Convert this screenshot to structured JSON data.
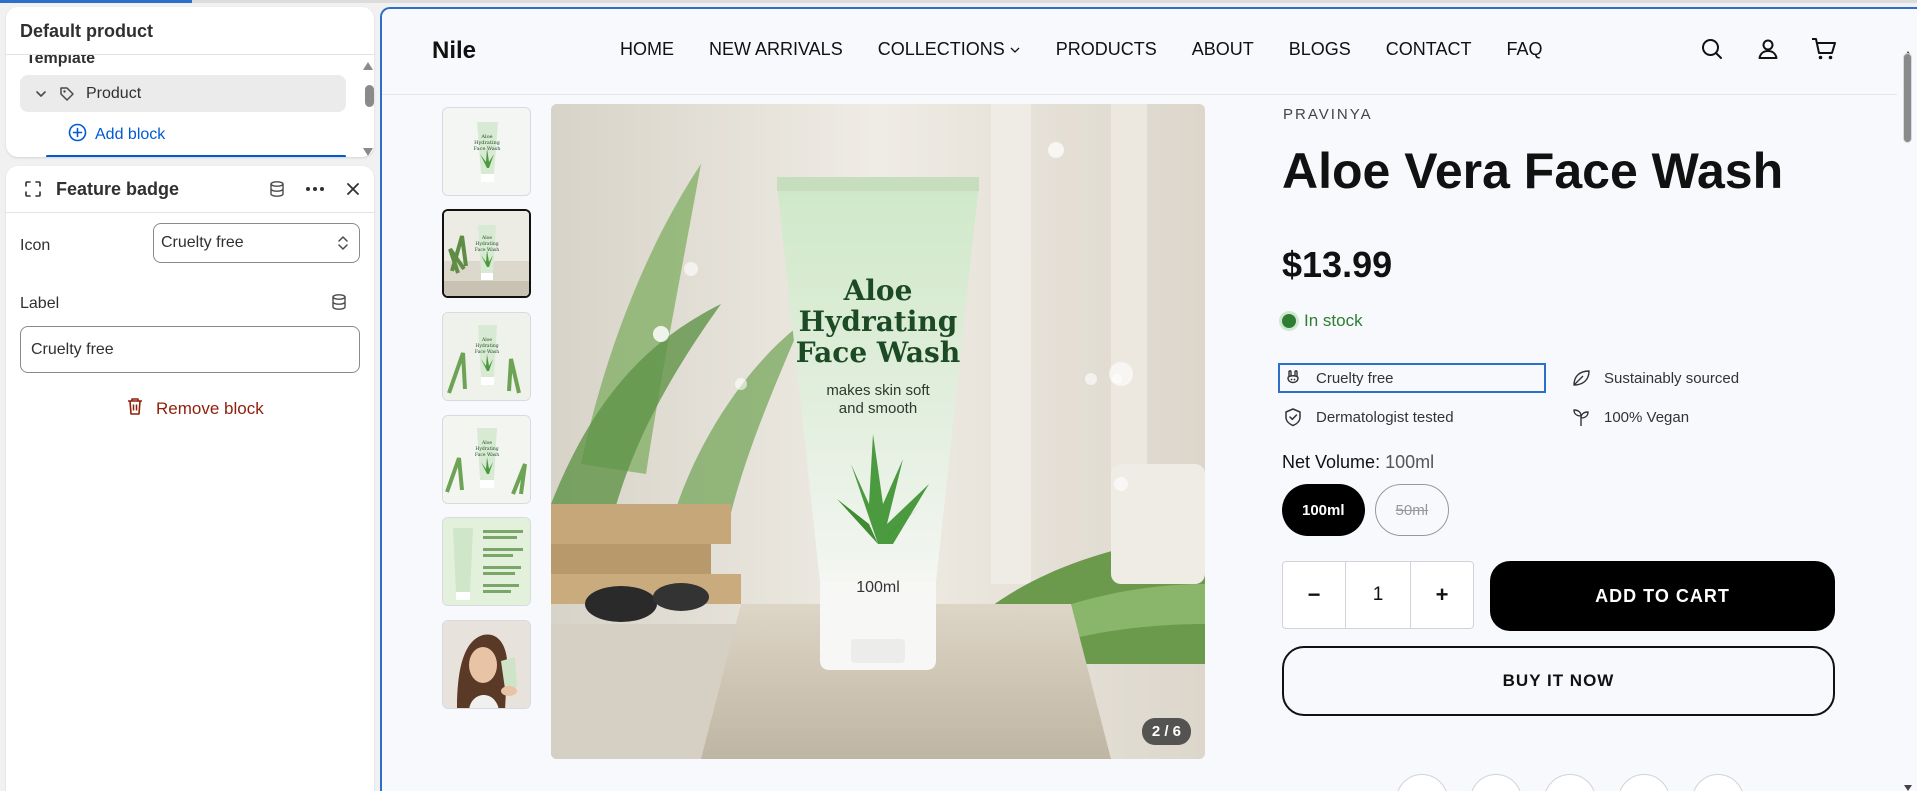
{
  "editor": {
    "tree": {
      "title": "Default product",
      "section_label": "Template",
      "product_label": "Product",
      "add_block_label": "Add block"
    },
    "block": {
      "title": "Feature badge",
      "icon_field_label": "Icon",
      "icon_value": "Cruelty free",
      "label_field_label": "Label",
      "label_value": "Cruelty free",
      "remove_label": "Remove block"
    }
  },
  "preview": {
    "logo": "Nile",
    "nav": [
      "HOME",
      "NEW ARRIVALS",
      "COLLECTIONS",
      "PRODUCTS",
      "ABOUT",
      "BLOGS",
      "CONTACT",
      "FAQ"
    ],
    "header_icons": [
      "search-icon",
      "account-icon",
      "cart-icon"
    ],
    "product": {
      "vendor": "PRAVINYA",
      "title": "Aloe Vera Face Wash",
      "price": "$13.99",
      "stock": "In stock",
      "badges": [
        {
          "icon": "cruelty-free-icon",
          "label": "Cruelty free"
        },
        {
          "icon": "leaf-icon",
          "label": "Sustainably sourced"
        },
        {
          "icon": "shield-icon",
          "label": "Dermatologist tested"
        },
        {
          "icon": "sprout-icon",
          "label": "100% Vegan"
        }
      ],
      "option_name": "Net Volume",
      "option_value": "100ml",
      "variants": [
        "100ml",
        "50ml"
      ],
      "quantity": "1",
      "qty_minus": "−",
      "qty_plus": "+",
      "add_to_cart": "ADD TO CART",
      "buy_now": "BUY IT NOW",
      "image_counter": "2 / 6",
      "tube": {
        "name_line1": "Aloe",
        "name_line2": "Hydrating",
        "name_line3": "Face Wash",
        "tagline1": "makes skin soft",
        "tagline2": "and smooth",
        "volume": "100ml"
      },
      "thumb_tube_text": [
        "Aloe",
        "Hydrating",
        "Face Wash"
      ]
    }
  },
  "colors": {
    "accent": "#2c6ecb",
    "danger": "#8e1f0b",
    "in_stock": "#2e7d32",
    "button": "#000000"
  }
}
